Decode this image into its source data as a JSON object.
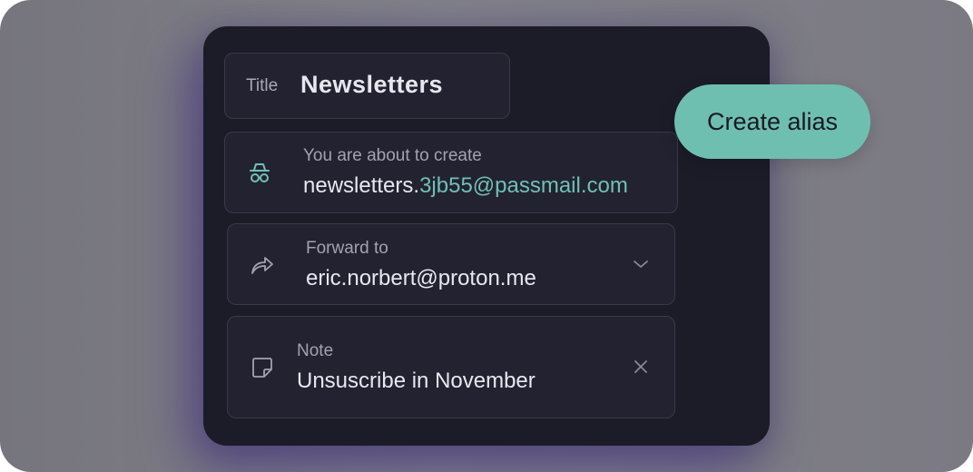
{
  "title_field": {
    "label": "Title",
    "value": "Newsletters"
  },
  "alias_preview": {
    "icon": "incognito-icon",
    "label": "You are about to create",
    "prefix": "newsletters.",
    "suffix": "3jb55@passmail.com"
  },
  "forward_field": {
    "icon": "forward-arrow-icon",
    "label": "Forward to",
    "value": "eric.norbert@proton.me",
    "action_icon": "chevron-down-icon"
  },
  "note_field": {
    "icon": "note-icon",
    "label": "Note",
    "value": "Unsuscribe in November",
    "action_icon": "close-icon"
  },
  "create_button": {
    "label": "Create alias"
  },
  "colors": {
    "accent": "#6fc1b4",
    "panel": "#1c1b28",
    "field": "#232231",
    "button": "#6fbfb0"
  }
}
